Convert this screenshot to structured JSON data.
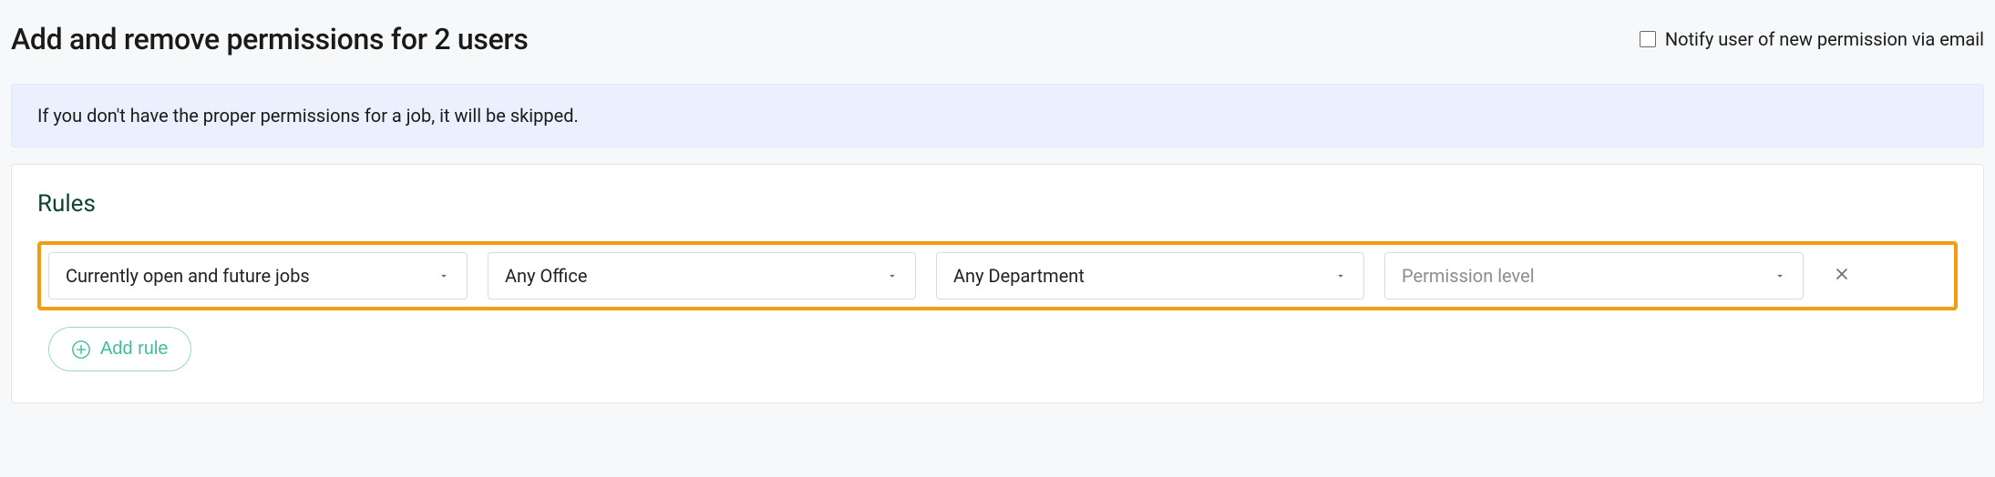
{
  "header": {
    "title": "Add and remove permissions for 2 users",
    "notify_label": "Notify user of new permission via email",
    "notify_checked": false
  },
  "info_banner": {
    "text": "If you don't have the proper permissions for a job, it will be skipped."
  },
  "rules": {
    "heading": "Rules",
    "row": {
      "job_scope": {
        "value": "Currently open and future jobs"
      },
      "office": {
        "value": "Any Office"
      },
      "department": {
        "value": "Any Department"
      },
      "permission_level": {
        "placeholder": "Permission level"
      }
    },
    "add_rule_label": "Add rule"
  }
}
